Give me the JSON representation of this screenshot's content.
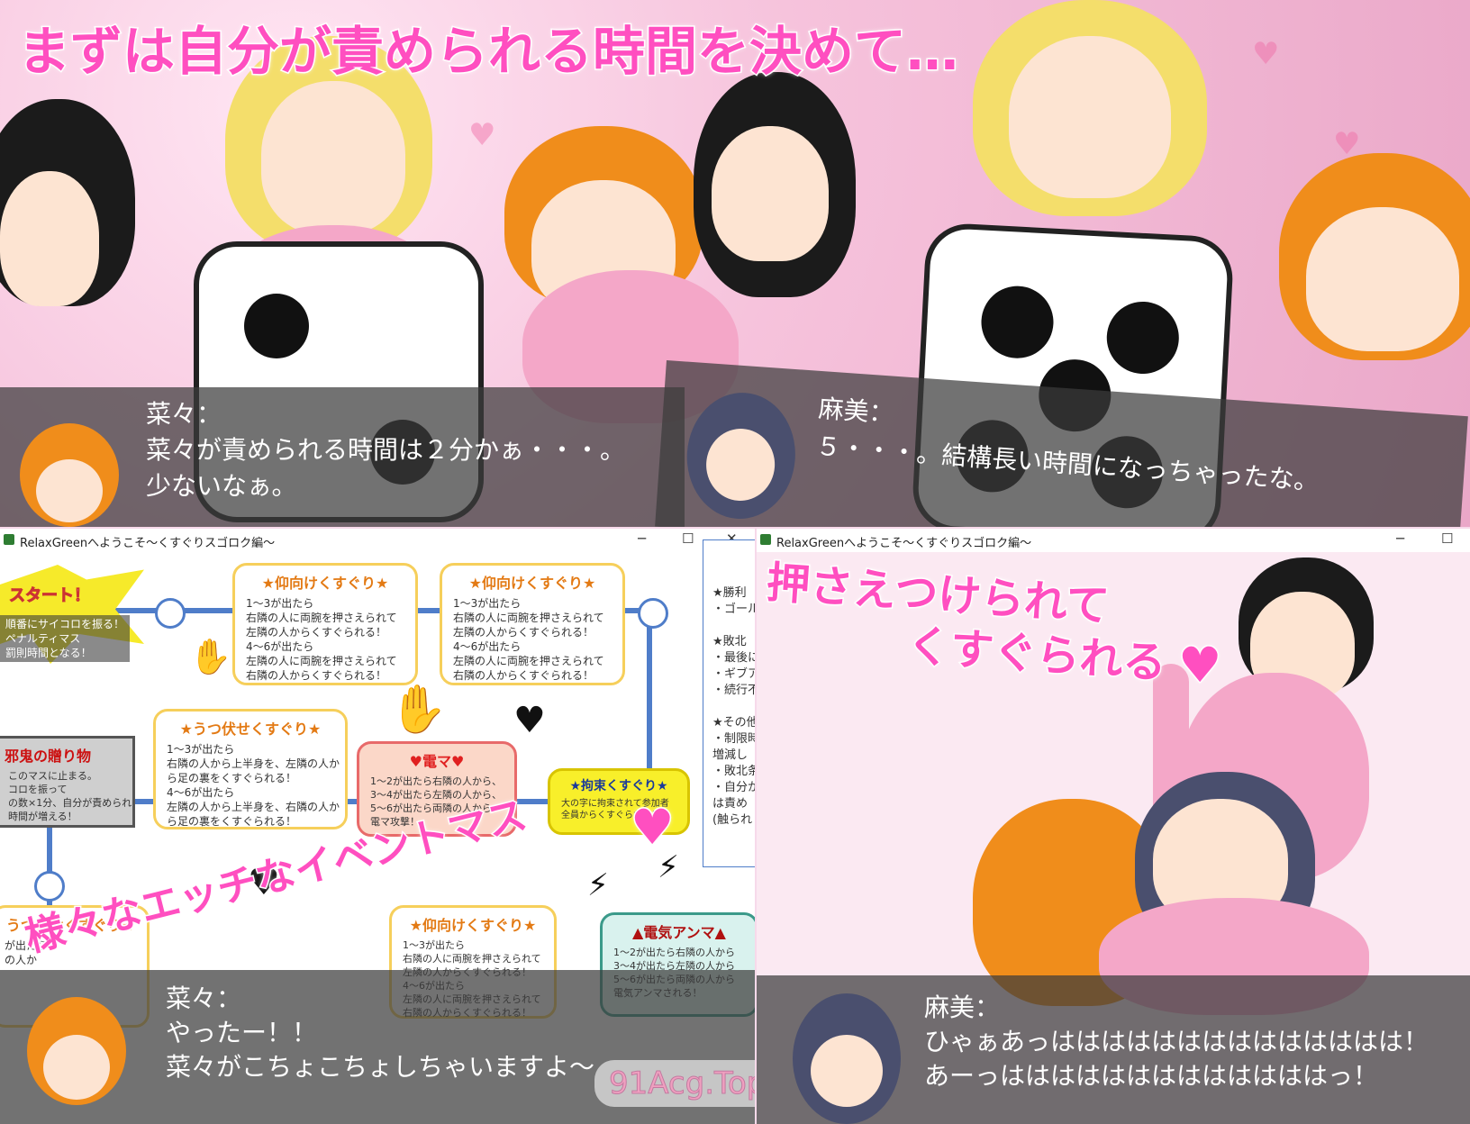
{
  "top_caption": "まずは自分が責められる時間を決めて…",
  "panel1": {
    "left_dialog": {
      "name": "菜々：",
      "line1": "菜々が責められる時間は２分かぁ・・・。",
      "line2": "少ないなぁ。"
    },
    "right_dialog": {
      "name": "麻美：",
      "line1": "５・・・。結構長い時間になっちゃったな。"
    }
  },
  "board_window": {
    "title": "RelaxGreenへようこそ〜くすぐりスゴロク編〜",
    "controls": {
      "minimize": "─",
      "maximize": "☐",
      "close": "✕"
    },
    "start_label": "スタート！",
    "start_lines": [
      "順番にサイコロを振る！",
      "ペナルティマス",
      "罰則時間となる！"
    ],
    "cards": [
      {
        "title": "★仰向けくすぐり★",
        "body": "1〜3が出たら\n右隣の人に両腕を押さえられて\n左隣の人からくすぐられる！\n4〜6が出たら\n左隣の人に両腕を押さえられて\n右隣の人からくすぐられる！"
      },
      {
        "title": "★仰向けくすぐり★",
        "body": "1〜3が出たら\n右隣の人に両腕を押さえられて\n左隣の人からくすぐられる！\n4〜6が出たら\n左隣の人に両腕を押さえられて\n右隣の人からくすぐられる！"
      },
      {
        "title": "★うつ伏せくすぐり★",
        "body": "1〜3が出たら\n右隣の人から上半身を、左隣の人か\nら足の裏をくすぐられる！\n4〜6が出たら\n左隣の人から上半身を、右隣の人か\nら足の裏をくすぐられる！"
      },
      {
        "title": "♥電マ♥",
        "body": "1〜2が出たら右隣の人から、\n3〜4が出たら左隣の人から、\n5〜6が出たら両隣の人から\n電マ攻撃！"
      },
      {
        "title": "★拘束くすぐり★",
        "body": "大の字に拘束されて参加者\n全員からくすぐられる！"
      },
      {
        "title": "邪鬼の贈り物",
        "body": "このマスに止まる。\nコロを振って\nの数×1分、自分が責められ\n時間が増える！"
      },
      {
        "title": "★仰向けくすぐり★",
        "body": "1〜3が出たら\n右隣の人に両腕を押さえられて\n左隣の人からくすぐられる！\n4〜6が出たら\n左隣の人に両腕を押さえられて\n右隣の人からくすぐられる！"
      },
      {
        "title": "▲電気アンマ▲",
        "body": "1〜2が出たら右隣の人から\n3〜4が出たら左隣の人から\n5〜6が出たら両隣の人から\n電気アンマされる！"
      },
      {
        "title": "うつ伏せくすぐり★",
        "body": "が出たら\nの人か"
      }
    ],
    "side_rules": "★勝利\n・ゴール\n\n★敗北\n・最後に\n・ギブア\n・続行不\n\n★その他\n・制限時\n増減し\n・敗北条\n・自分か\nは責め\n(触られ",
    "caption": "様々なエッチなイベントマス",
    "dialog": {
      "name": "菜々：",
      "line1": "やったー！！",
      "line2": "菜々がこちょこちょしちゃいますよ〜"
    },
    "watermark": "91Acg.Top"
  },
  "scene_window": {
    "title": "RelaxGreenへようこそ〜くすぐりスゴロク編〜",
    "controls": {
      "minimize": "─",
      "maximize": "☐"
    },
    "caption_line1": "押さえつけられて",
    "caption_line2": "くすぐられる",
    "dialog": {
      "name": "麻美：",
      "line1": "ひゃぁあっはははははははははははははは！",
      "line2": "あーっはははははははははははははっ！"
    }
  },
  "colors": {
    "caption_pink": "#ff4fc0",
    "track_blue": "#4f7dc9",
    "card_border": "#f6cf5b"
  }
}
